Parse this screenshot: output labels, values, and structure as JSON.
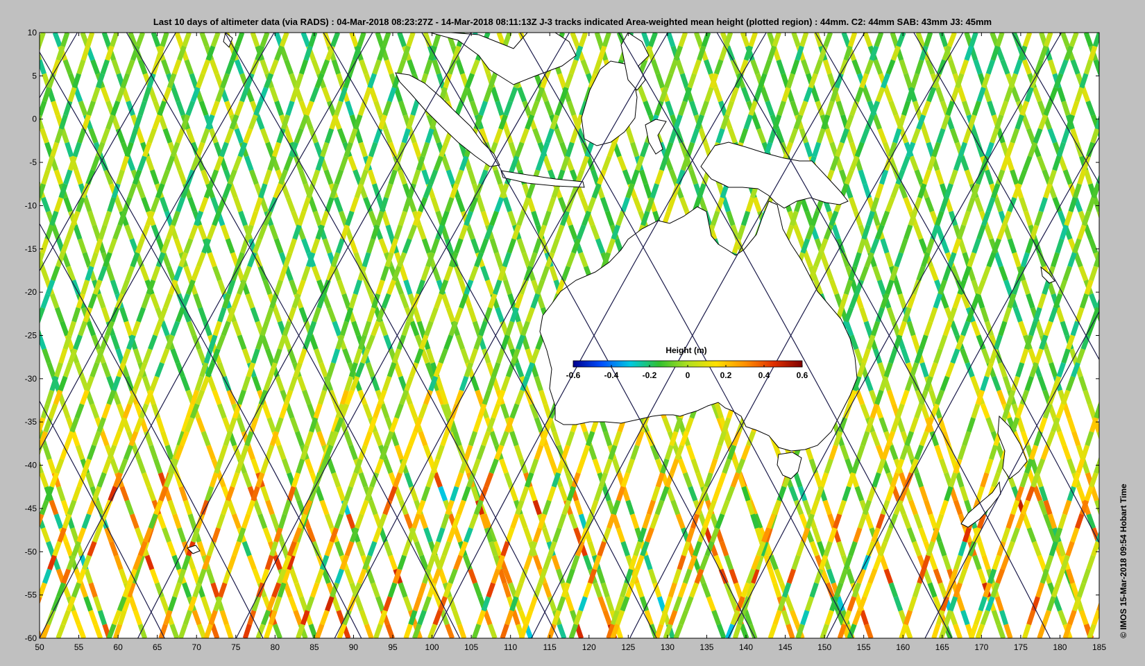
{
  "title": "Last 10 days of altimeter data (via RADS) : 04-Mar-2018 08:23:27Z - 14-Mar-2018 08:11:13Z  J-3 tracks indicated  Area-weighted mean height (plotted region) : 44mm.  C2: 44mm  SAB: 43mm  J3: 45mm",
  "credit": "©  IMOS 15-Mar-2018 09:54 Hobart Time",
  "map": {
    "lon_range": [
      50,
      185
    ],
    "lat_range": [
      -60,
      10
    ],
    "x_ticks": [
      "50",
      "55",
      "60",
      "65",
      "70",
      "75",
      "80",
      "85",
      "90",
      "95",
      "100",
      "105",
      "110",
      "115",
      "120",
      "125",
      "130",
      "135",
      "140",
      "145",
      "150",
      "155",
      "160",
      "165",
      "170",
      "175",
      "180",
      "185"
    ],
    "y_ticks": [
      "10",
      "5",
      "0",
      "-5",
      "-10",
      "-15",
      "-20",
      "-25",
      "-30",
      "-35",
      "-40",
      "-45",
      "-50",
      "-55",
      "-60"
    ],
    "land_color": "#ffffff",
    "coast_color": "#000000",
    "track_color": "#1a1a4a"
  },
  "colorbar": {
    "title": "Height (m)",
    "ticks": [
      "-0.6",
      "-0.4",
      "-0.2",
      "0",
      "0.2",
      "0.4",
      "0.6"
    ],
    "range": [
      -0.6,
      0.6
    ],
    "colors": [
      "#00008f",
      "#0050ff",
      "#00c8e0",
      "#30c030",
      "#b0e020",
      "#ffe000",
      "#ff9000",
      "#e03000",
      "#800000"
    ]
  }
}
